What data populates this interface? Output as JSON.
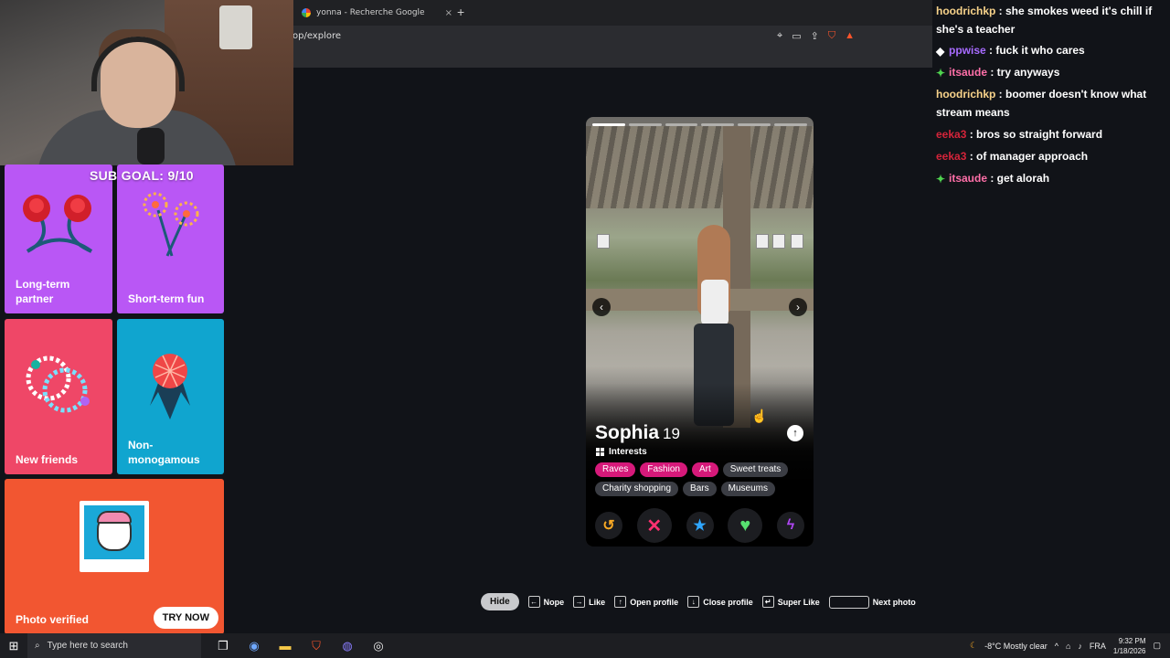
{
  "browser": {
    "tab_title": "yonna - Recherche Google",
    "url": "op/explore",
    "new_tab": "+",
    "tab_close": "×"
  },
  "stream": {
    "sub_goal": "SUB GOAL: 9/10"
  },
  "sidebar": {
    "cards": [
      {
        "label": "Long-term partner"
      },
      {
        "label": "Short-term fun"
      },
      {
        "label": "New friends"
      },
      {
        "label": "Non-monogamous"
      },
      {
        "label": "Photo verified",
        "button": "TRY NOW"
      }
    ]
  },
  "chat": [
    {
      "user": "hoodrichkp",
      "text": " : she smokes weed it's chill if she's a teacher",
      "color": "#f7d28a"
    },
    {
      "user": "ppwise",
      "text": " : fuck it who cares",
      "color": "#a76bff"
    },
    {
      "user": "itsaude",
      "text": " : try anyways",
      "color": "#ff6fa8"
    },
    {
      "user": "hoodrichkp",
      "text": " : boomer doesn't know what stream means",
      "color": "#f7d28a"
    },
    {
      "user": "eeka3",
      "text": " : bros so straight forward",
      "color": "#d5243a"
    },
    {
      "user": "eeka3",
      "text": " : of manager approach",
      "color": "#d5243a"
    },
    {
      "user": "itsaude",
      "text": " : get alorah",
      "color": "#ff6fa8"
    }
  ],
  "profile": {
    "name": "Sophia",
    "age": "19",
    "interests_label": "Interests",
    "photo_index": 1,
    "photo_count": 6,
    "tags": [
      {
        "label": "Raves",
        "highlight": true
      },
      {
        "label": "Fashion",
        "highlight": true
      },
      {
        "label": "Art",
        "highlight": true
      },
      {
        "label": "Sweet treats",
        "highlight": false
      },
      {
        "label": "Charity shopping",
        "highlight": false
      },
      {
        "label": "Bars",
        "highlight": false
      },
      {
        "label": "Museums",
        "highlight": false
      }
    ]
  },
  "hints": {
    "hide": "Hide",
    "nope": "Nope",
    "like": "Like",
    "open_profile": "Open profile",
    "close_profile": "Close profile",
    "super_like": "Super Like",
    "next_photo": "Next photo"
  },
  "taskbar": {
    "search_placeholder": "Type here to search",
    "weather": "-8°C  Mostly clear",
    "lang": "FRA",
    "time": "9:32 PM",
    "date": "1/18/2026"
  },
  "colors": {
    "accent_pink": "#d6197a",
    "rewind": "#f7a824",
    "nope": "#ff3070",
    "super_like": "#2fa6ff",
    "like": "#57e070",
    "boost": "#b146f5"
  }
}
